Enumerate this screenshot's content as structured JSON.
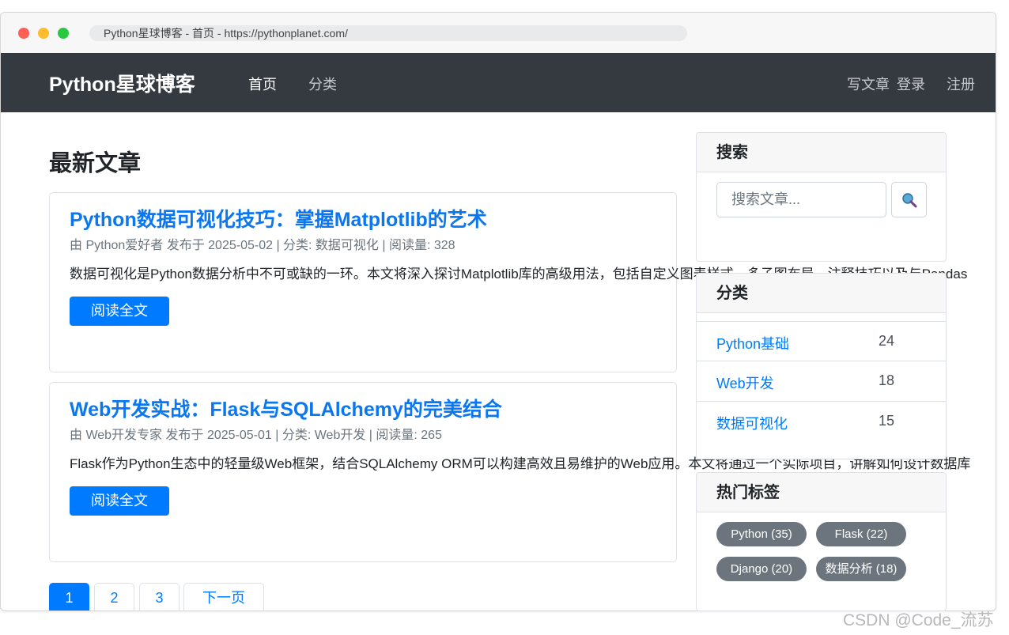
{
  "browser": {
    "url_text": "Python星球博客 - 首页 - https://pythonplanet.com/"
  },
  "navbar": {
    "brand": "Python星球博客",
    "links": [
      "首页",
      "分类"
    ],
    "right_links": [
      "写文章",
      "登录",
      "注册"
    ]
  },
  "main": {
    "heading": "最新文章",
    "posts": [
      {
        "title": "Python数据可视化技巧：掌握Matplotlib的艺术",
        "meta": "由 Python爱好者 发布于 2025-05-02 | 分类: 数据可视化 | 阅读量: 328",
        "excerpt": "数据可视化是Python数据分析中不可或缺的一环。本文将深入探讨Matplotlib库的高级用法，包括自定义图表样式、多子图布局、注释技巧以及与Pandas",
        "button": "阅读全文"
      },
      {
        "title": "Web开发实战：Flask与SQLAlchemy的完美结合",
        "meta": "由 Web开发专家 发布于 2025-05-01 | 分类: Web开发 | 阅读量: 265",
        "excerpt": "Flask作为Python生态中的轻量级Web框架，结合SQLAlchemy ORM可以构建高效且易维护的Web应用。本文将通过一个实际项目，讲解如何设计数据库",
        "button": "阅读全文"
      }
    ],
    "pagination": [
      "1",
      "2",
      "3",
      "下一页"
    ]
  },
  "sidebar": {
    "search": {
      "title": "搜索",
      "placeholder": "搜索文章...",
      "button_icon": "search-icon"
    },
    "categories": {
      "title": "分类",
      "items": [
        {
          "name": "Python基础",
          "count": "24"
        },
        {
          "name": "Web开发",
          "count": "18"
        },
        {
          "name": "数据可视化",
          "count": "15"
        }
      ]
    },
    "tags": {
      "title": "热门标签",
      "items": [
        "Python (35)",
        "Flask (22)",
        "Django (20)",
        "数据分析 (18)"
      ]
    }
  },
  "watermark": "CSDN @Code_流苏",
  "colors": {
    "navbar": "#343a40",
    "primary": "#007bff",
    "tag": "#6c757d"
  }
}
